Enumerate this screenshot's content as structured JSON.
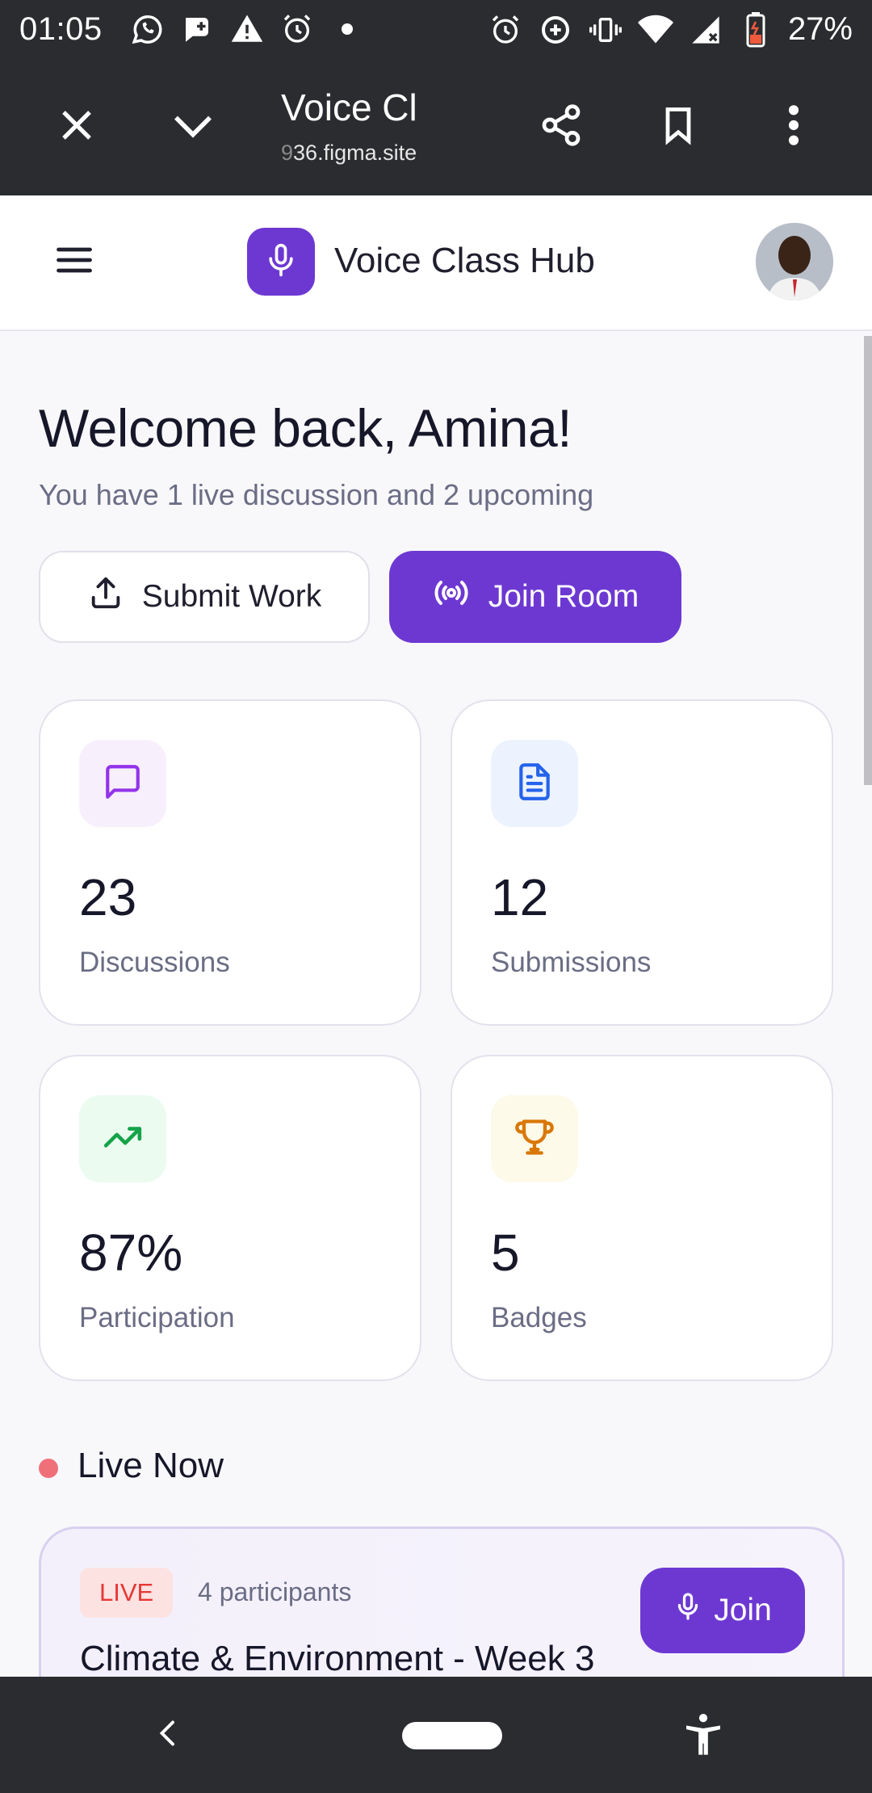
{
  "status_bar": {
    "time": "01:05",
    "battery": "27%",
    "left_icons": [
      "whatsapp-icon",
      "chat-plus-icon",
      "warning-icon",
      "alarm-icon",
      "dot-icon"
    ],
    "right_icons": [
      "alarm-icon",
      "data-saver-icon",
      "vibrate-icon",
      "wifi-icon",
      "signal-icon",
      "battery-icon"
    ]
  },
  "browser": {
    "title": "Voice Cl",
    "url_faded": "9",
    "url": "36.figma.site",
    "icons": [
      "close-icon",
      "chevron-down-icon",
      "share-icon",
      "bookmark-icon",
      "more-vertical-icon"
    ]
  },
  "app": {
    "title": "Voice Class Hub",
    "accent": "#6d38d2",
    "welcome": "Welcome back, Amina!",
    "subtitle": "You have 1 live discussion and 2 upcoming",
    "submit_button": "Submit Work",
    "join_room_button": "Join Room"
  },
  "stats": [
    {
      "value": "23",
      "label": "Discussions",
      "icon": "message-square-icon",
      "color": "#9333ea",
      "bg": "#f8effd"
    },
    {
      "value": "12",
      "label": "Submissions",
      "icon": "file-text-icon",
      "color": "#2563eb",
      "bg": "#ecf3fe"
    },
    {
      "value": "87%",
      "label": "Participation",
      "icon": "trending-up-icon",
      "color": "#16a34a",
      "bg": "#ecfbf0"
    },
    {
      "value": "5",
      "label": "Badges",
      "icon": "trophy-icon",
      "color": "#d97706",
      "bg": "#fefaea"
    }
  ],
  "live": {
    "heading": "Live Now",
    "badge": "LIVE",
    "participants": "4 participants",
    "title": "Climate & Environment - Week 3",
    "join_button": "Join"
  }
}
